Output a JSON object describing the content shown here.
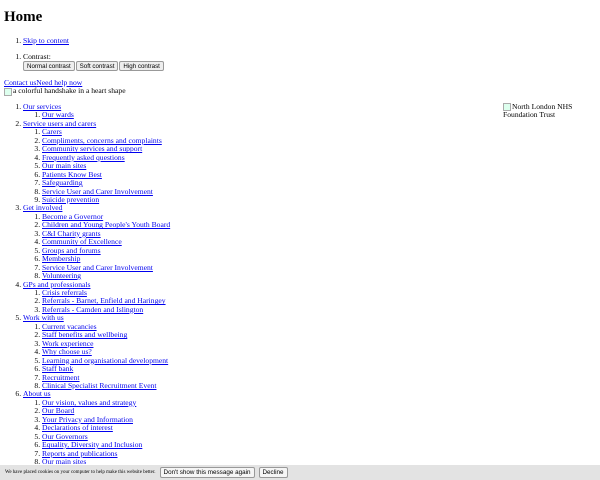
{
  "page_title": "Home",
  "skip_link": "Skip to content",
  "contrast": {
    "label": "Contrast:",
    "buttons": [
      "Normal contrast",
      "Soft contrast",
      "High contrast"
    ]
  },
  "top_links": {
    "contact": "Contact us",
    "help": "Need help now"
  },
  "hero_alt": "a colorful handshake in a heart shape",
  "logo_alt": "North London NHS Foundation Trust",
  "nav": [
    {
      "label": "Our services",
      "children": [
        "Our wards"
      ]
    },
    {
      "label": "Service users and carers",
      "children": [
        "Carers",
        "Compliments, concerns and complaints",
        "Community services and support",
        "Frequently asked questions",
        "Our main sites",
        "Patients Know Best",
        "Safeguarding",
        "Service User and Carer Involvement",
        "Suicide prevention"
      ]
    },
    {
      "label": "Get involved",
      "children": [
        "Become a Governor",
        "Children and Young People's Youth Board",
        "C&I Charity grants",
        "Community of Excellence",
        "Groups and forums",
        "Membership",
        "Service User and Carer Involvement",
        "Volunteering"
      ]
    },
    {
      "label": "GPs and professionals",
      "children": [
        "Crisis referrals",
        "Referrals - Barnet, Enfield and Haringey",
        "Referrals - Camden and Islington"
      ]
    },
    {
      "label": "Work with us",
      "children": [
        "Current vacancies",
        "Staff benefits and wellbeing",
        "Work experience",
        "Why choose us?",
        "Learning and organisational development",
        "Staff bank",
        "Recruitment",
        "Clinical Specialist Recruitment Event"
      ]
    },
    {
      "label": "About us",
      "children": [
        "Our vision, values and strategy",
        "Our Board",
        "Your Privacy and Information",
        "Declarations of interest",
        "Our Governors",
        "Equality, Diversity and Inclusion",
        "Reports and publications",
        "Our main sites"
      ]
    }
  ],
  "cookie": {
    "message": "We have placed cookies on your computer to help make this website better.",
    "dismiss": "Don't show this message again",
    "decline": "Decline"
  }
}
